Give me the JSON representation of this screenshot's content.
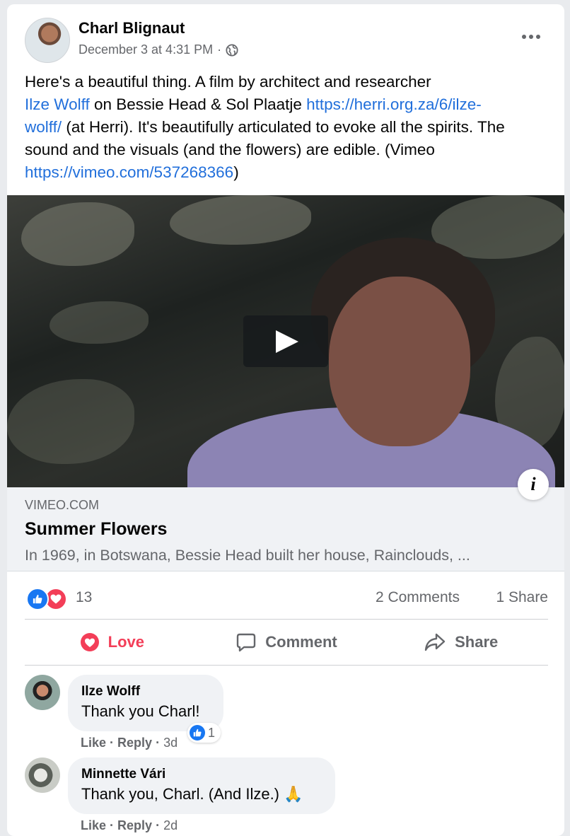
{
  "post": {
    "author": "Charl Blignaut",
    "date": "December 3 at 4:31 PM",
    "separator": "·",
    "privacy_icon": "globe-icon",
    "text_1": "Here's a beautiful thing. A film by architect and researcher",
    "mention": "Ilze Wolff",
    "text_2": " on Bessie Head & Sol Plaatje ",
    "link_1a": "https://herri.org.za/6/ilze-",
    "link_1b": "wolff/",
    "text_3": " (at Herri). It's beautifully articulated to evoke all the spirits. The sound and the visuals (and the flowers) are edible. (Vimeo ",
    "link_2": "https://vimeo.com/537268366",
    "text_4": ")"
  },
  "preview": {
    "domain": "VIMEO.COM",
    "title": "Summer Flowers",
    "description": "In 1969, in Botswana, Bessie Head built her house, Rainclouds, ...",
    "info_label": "i"
  },
  "stats": {
    "reactions": "13",
    "comments": "2 Comments",
    "shares": "1 Share"
  },
  "actions": {
    "love": "Love",
    "comment": "Comment",
    "share": "Share"
  },
  "comments": [
    {
      "name": "Ilze Wolff",
      "text": "Thank you Charl!",
      "like": "Like",
      "reply": "Reply",
      "time": "3d",
      "reaction_count": "1"
    },
    {
      "name": "Minnette Vári",
      "text": "Thank you, Charl. (And Ilze.) 🙏",
      "like": "Like",
      "reply": "Reply",
      "time": "2d"
    }
  ],
  "colors": {
    "link": "#216fdb",
    "love": "#f33e58",
    "like": "#1877f2",
    "secondary_text": "#65676b"
  }
}
